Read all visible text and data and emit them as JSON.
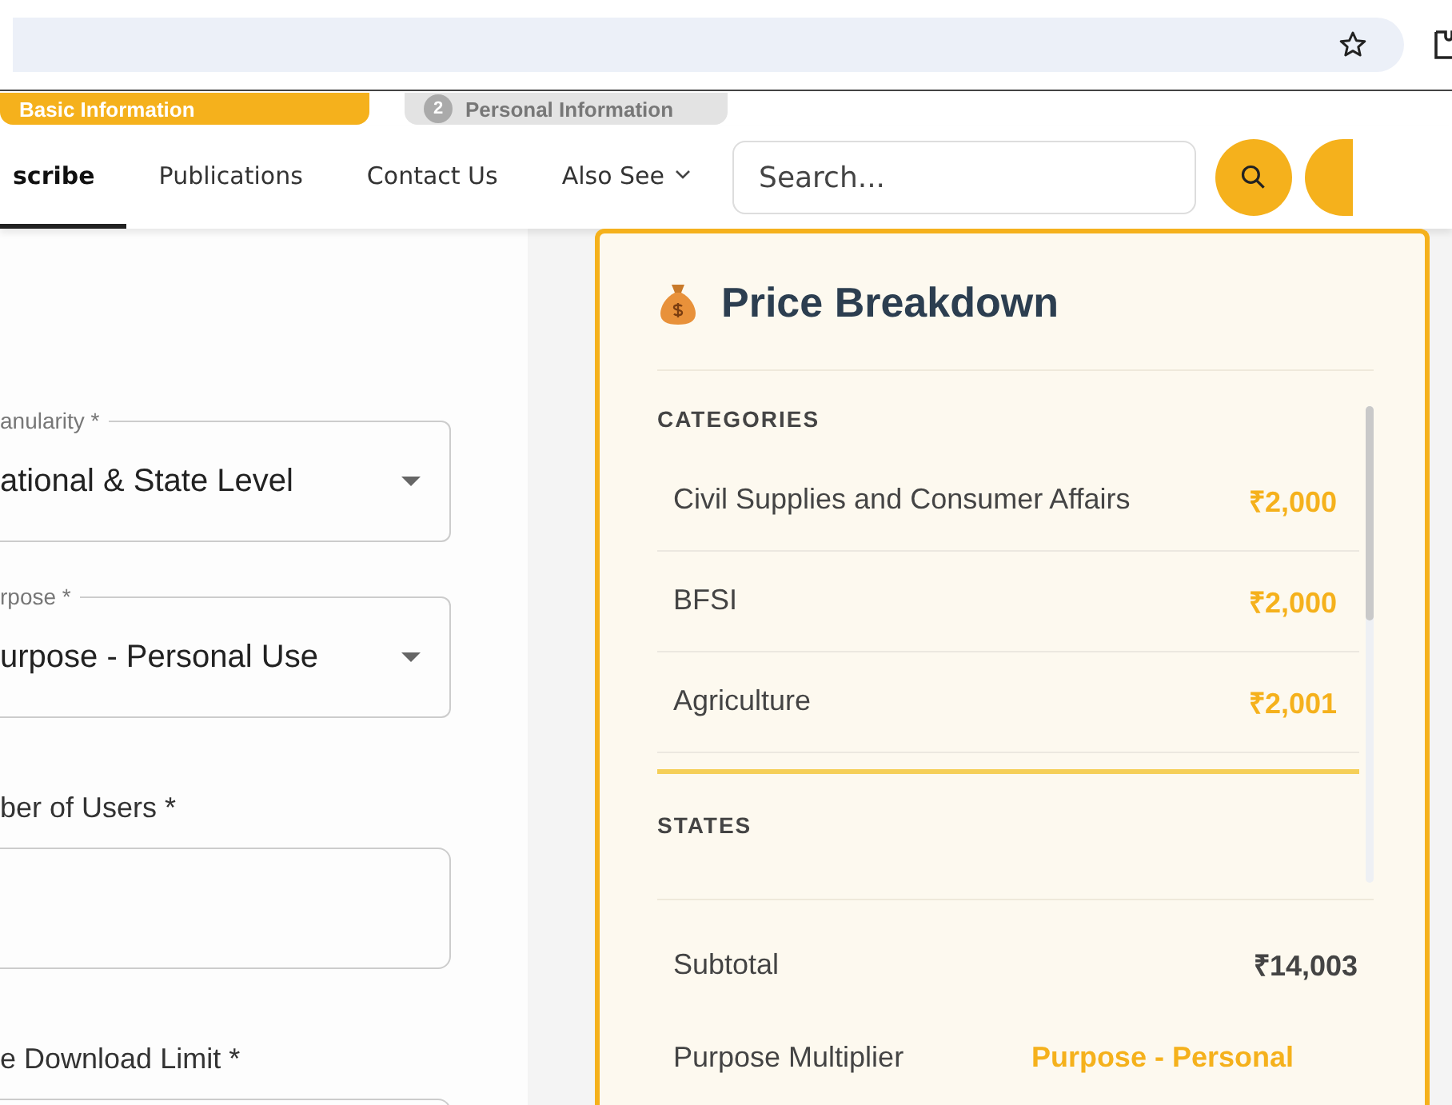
{
  "steps": [
    {
      "label": "Basic Information",
      "selected": true
    },
    {
      "number": "2",
      "label": "Personal Information",
      "selected": false
    }
  ],
  "nav": {
    "items": [
      {
        "label": "scribe",
        "selected": true,
        "dropdown": false
      },
      {
        "label": "Publications",
        "selected": false,
        "dropdown": false
      },
      {
        "label": "Contact Us",
        "selected": false,
        "dropdown": false
      },
      {
        "label": "Also See",
        "selected": false,
        "dropdown": true
      }
    ],
    "search": {
      "placeholder": "Search..."
    }
  },
  "form": {
    "fields": [
      {
        "kind": "select",
        "label": "anularity *",
        "value": "ational & State Level"
      },
      {
        "kind": "select",
        "label": "rpose *",
        "value": "urpose - Personal Use"
      },
      {
        "kind": "input",
        "label": "ber of Users *"
      },
      {
        "kind": "input",
        "label": "e Download Limit *"
      }
    ]
  },
  "price_panel": {
    "title": "Price Breakdown",
    "sections": [
      {
        "heading": "CATEGORIES",
        "rows": [
          {
            "name": "Civil Supplies and Consumer Affairs",
            "amount": "₹2,000"
          },
          {
            "name": "BFSI",
            "amount": "₹2,000"
          },
          {
            "name": "Agriculture",
            "amount": "₹2,001"
          }
        ]
      },
      {
        "heading": "STATES"
      }
    ],
    "summary": [
      {
        "kind": "plain",
        "label": "Subtotal",
        "value": "₹14,003"
      },
      {
        "kind": "accent",
        "label": "Purpose Multiplier",
        "value": "Purpose - Personal"
      }
    ]
  }
}
